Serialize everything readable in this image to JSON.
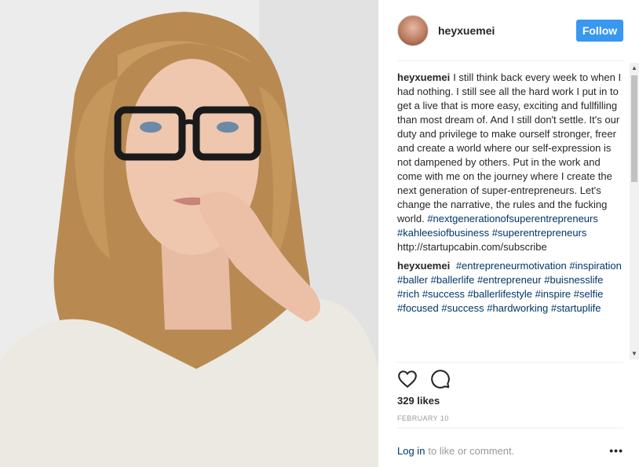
{
  "post": {
    "username": "heyxuemei",
    "follow_label": "Follow",
    "photo_alt": "Portrait photo"
  },
  "comments": [
    {
      "author": "heyxuemei",
      "text": "I still think back every week to when I had nothing. I still see all the hard work I put in to get a live that is more easy, exciting and fullfilling than most dream of. And I still don't settle. It's our duty and privilege to make ourself stronger, freer and create a world where our self-expression is not dampened by others. Put in the work and come with me on the journey where I create the next generation of super-entrepreneurs. Let's change the narrative, the rules and the fucking world.",
      "hashtags": [
        "#nextgenerationofsuperentrepreneurs",
        "#kahleesiofbusiness",
        "#superentrepreneurs"
      ],
      "link": "http://startupcabin.com/subscribe"
    },
    {
      "author": "heyxuemei",
      "hashtags": [
        "#entrepreneurmotivation",
        "#inspiration",
        "#baller",
        "#ballerlife",
        "#entrepreneur",
        "#buisnesslife",
        "#rich",
        "#success",
        "#ballerlifestyle",
        "#inspire",
        "#selfie",
        "#focused",
        "#success",
        "#hardworking",
        "#startuplife"
      ]
    }
  ],
  "actions": {
    "like_icon": "heart-icon",
    "comment_icon": "comment-icon"
  },
  "likes_label": "329 likes",
  "date_label": "February 10",
  "footer": {
    "login_label": "Log in",
    "login_suffix": "to like or comment.",
    "more_label": "•••"
  },
  "colors": {
    "follow_button": "#3897f0",
    "hashtag": "#003569",
    "muted": "#999999"
  }
}
